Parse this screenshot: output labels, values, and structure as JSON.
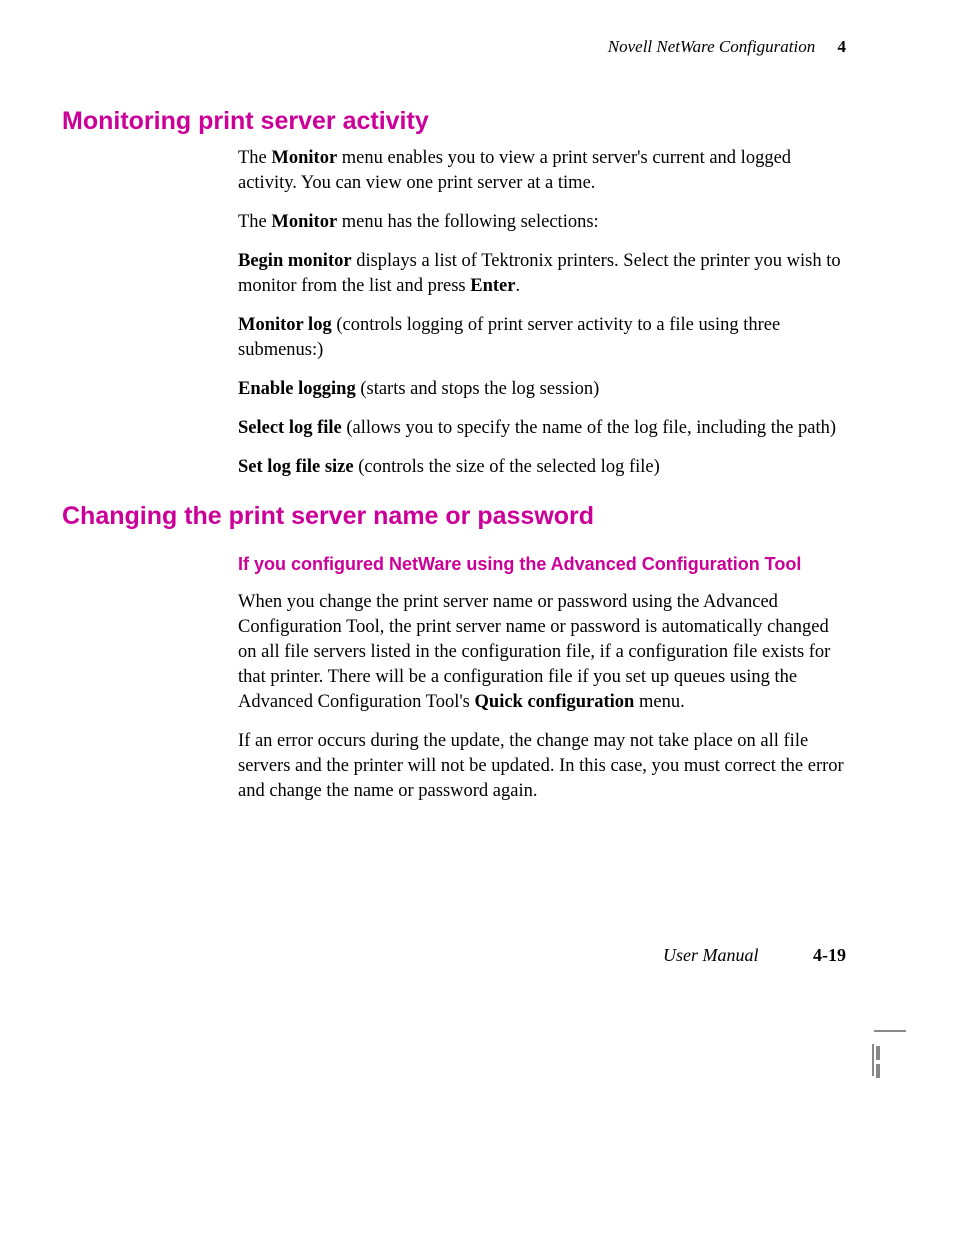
{
  "header": {
    "running_title": "Novell NetWare Configuration",
    "chapter_num": "4"
  },
  "section1": {
    "heading": "Monitoring print server activity",
    "p1_a": "The ",
    "p1_b": "Monitor",
    "p1_c": " menu enables you to view a print server's current and logged activity.  You can view one print server at a time.",
    "p2_a": "The ",
    "p2_b": "Monitor",
    "p2_c": " menu has the following selections:",
    "begin_a": "Begin monitor",
    "begin_b": " displays a list of Tektronix printers.  Select the printer you wish to monitor from the list and press ",
    "begin_c": "Enter",
    "begin_d": ".",
    "mlog_a": "Monitor log",
    "mlog_b": " (controls logging of print server activity to a file using three submenus:)",
    "enlog_a": "Enable logging",
    "enlog_b": " (starts and stops the log session)",
    "sellog_a": "Select log file",
    "sellog_b": " (allows you to specify the name of the log file, including the path)",
    "setlog_a": "Set log file size",
    "setlog_b": " (controls the size of the selected log file)"
  },
  "section2": {
    "heading": "Changing the print server name or password",
    "subheading": "If you configured NetWare using the Advanced Configuration Tool",
    "p1_a": "When you change the print server name or password using the Advanced Configuration Tool, the print server name or password is automatically changed on all file servers listed in the configuration file, if a configuration file exists for that printer.  There will be a configuration file if you set up queues using the Advanced Configuration Tool's ",
    "p1_b": "Quick configuration",
    "p1_c": " menu.",
    "p2": "If an error occurs during the update, the change may not take place on all file servers and the printer will not be updated.  In this case, you must correct the error and change the name or password again."
  },
  "footer": {
    "label": "User Manual",
    "page": "4-19"
  }
}
